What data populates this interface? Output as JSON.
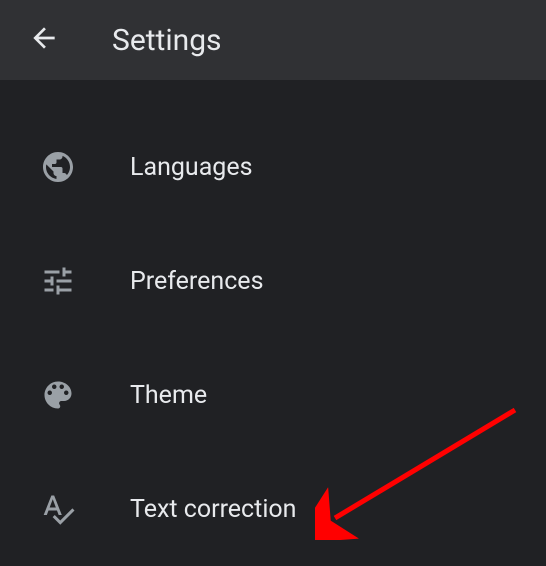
{
  "header": {
    "title": "Settings"
  },
  "items": [
    {
      "label": "Languages"
    },
    {
      "label": "Preferences"
    },
    {
      "label": "Theme"
    },
    {
      "label": "Text correction"
    }
  ]
}
